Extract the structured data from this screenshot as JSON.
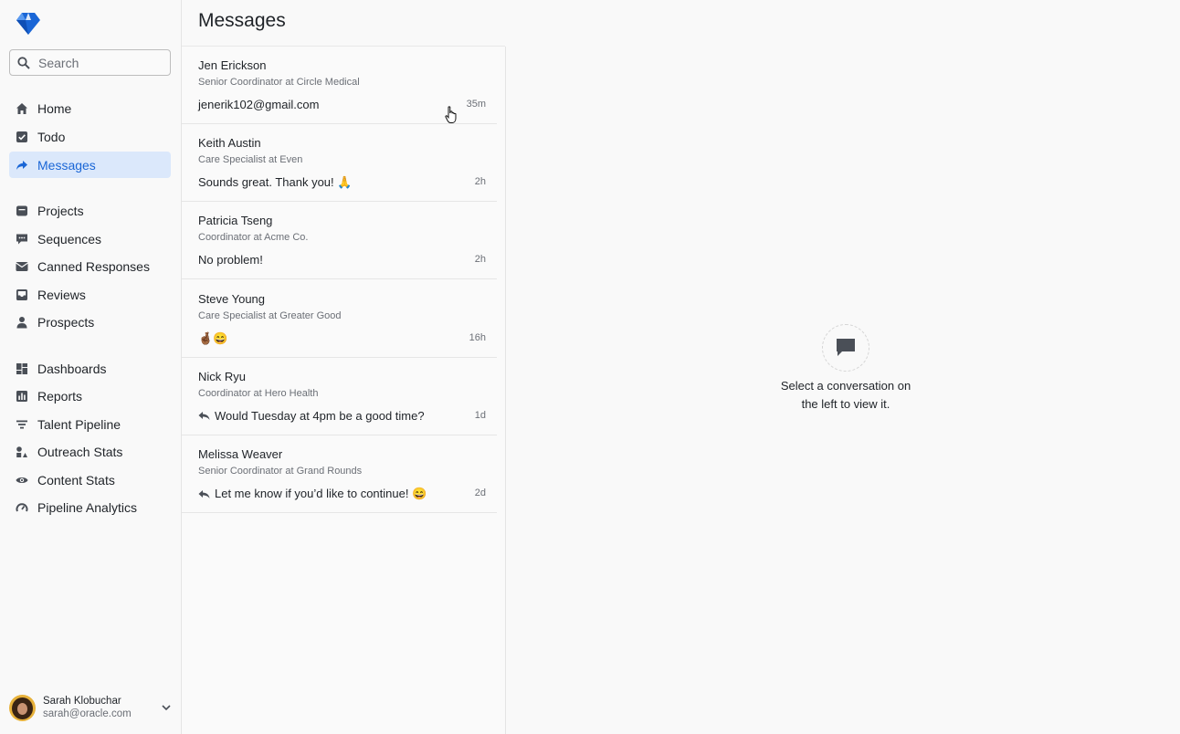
{
  "sidebar": {
    "search": {
      "placeholder": "Search"
    },
    "nav_primary": [
      {
        "label": "Home",
        "icon": "home-icon"
      },
      {
        "label": "Todo",
        "icon": "checkbox-icon"
      },
      {
        "label": "Messages",
        "icon": "share-arrow-icon",
        "active": true
      }
    ],
    "nav_secondary": [
      {
        "label": "Projects",
        "icon": "folder-icon"
      },
      {
        "label": "Sequences",
        "icon": "chat-bubble-icon"
      },
      {
        "label": "Canned Responses",
        "icon": "envelope-icon"
      },
      {
        "label": "Reviews",
        "icon": "inbox-icon"
      },
      {
        "label": "Prospects",
        "icon": "person-icon"
      }
    ],
    "nav_tertiary": [
      {
        "label": "Dashboards",
        "icon": "dashboard-icon"
      },
      {
        "label": "Reports",
        "icon": "bar-chart-icon"
      },
      {
        "label": "Talent Pipeline",
        "icon": "filter-icon"
      },
      {
        "label": "Outreach Stats",
        "icon": "shapes-icon"
      },
      {
        "label": "Content Stats",
        "icon": "eye-icon"
      },
      {
        "label": "Pipeline Analytics",
        "icon": "gauge-icon"
      }
    ],
    "user": {
      "name": "Sarah Klobuchar",
      "email": "sarah@oracle.com"
    }
  },
  "header": {
    "title": "Messages"
  },
  "conversations": [
    {
      "name": "Jen Erickson",
      "title": "Senior Coordinator at Circle Medical",
      "message": "jenerik102@gmail.com",
      "time": "35m",
      "replied": false
    },
    {
      "name": "Keith Austin",
      "title": "Care Specialist at Even",
      "message": "Sounds great. Thank you! 🙏",
      "time": "2h",
      "replied": false
    },
    {
      "name": "Patricia Tseng",
      "title": "Coordinator at Acme Co.",
      "message": "No problem!",
      "time": "2h",
      "replied": false
    },
    {
      "name": "Steve Young",
      "title": "Care Specialist at Greater Good",
      "message": "🤞🏾😄",
      "time": "16h",
      "replied": false
    },
    {
      "name": "Nick Ryu",
      "title": "Coordinator at Hero Health",
      "message": "Would Tuesday at 4pm be a good time?",
      "time": "1d",
      "replied": true
    },
    {
      "name": "Melissa Weaver",
      "title": "Senior Coordinator at Grand Rounds",
      "message": "Let me know if you’d like to continue! 😄",
      "time": "2d",
      "replied": true
    }
  ],
  "empty_state": {
    "line1": "Select a conversation on",
    "line2": "the left to view it."
  },
  "colors": {
    "accent": "#1a66d6",
    "active_bg": "#dbe8fb",
    "text": "#1f2328",
    "muted": "#6b6f76"
  }
}
